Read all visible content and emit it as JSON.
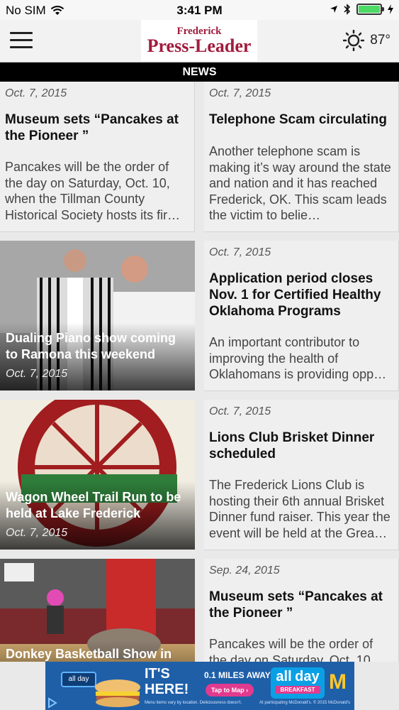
{
  "status": {
    "carrier": "No SIM",
    "time": "3:41 PM"
  },
  "header": {
    "logo_top": "Frederick",
    "logo_main": "Press-Leader",
    "temperature": "87°"
  },
  "section": "NEWS",
  "articles": [
    {
      "date": "Oct. 7, 2015",
      "title": "Museum sets “Pancakes at the Pioneer ”",
      "excerpt": "Pancakes will be the order of the day on Saturday, Oct. 10, when the Tillman County Historical Society hosts its fir…"
    },
    {
      "date": "Oct. 7, 2015",
      "title": "Telephone Scam circulating",
      "excerpt": "Another telephone scam is making it’s way around the state and nation and it has reached Frederick, OK. This scam leads the victim to belie…"
    },
    {
      "date": "Oct. 7, 2015",
      "title": "Dualing Piano show coming to Ramona this weekend"
    },
    {
      "date": "Oct. 7, 2015",
      "title": "Application period closes Nov. 1 for Certified Healthy Oklahoma Programs",
      "excerpt": "An important contributor to improving the health of Oklahomans is providing opp…"
    },
    {
      "date": "Oct. 7, 2015",
      "title": "Wagon Wheel Trail Run to be held at Lake Frederick"
    },
    {
      "date": "Oct. 7, 2015",
      "title": "Lions Club Brisket Dinner scheduled",
      "excerpt": "The Frederick Lions Club is hosting their 6th annual Brisket Dinner fund raiser. This year the event will be held at the Grea…"
    },
    {
      "title": "Donkey Basketball Show in"
    },
    {
      "date": "Sep. 24, 2015",
      "title": "Museum sets “Pancakes at the Pioneer ”",
      "excerpt": "Pancakes will be the order of the day on Saturday, Oct. 10"
    }
  ],
  "ad": {
    "small_tag": "all day",
    "headline_1": "IT'S",
    "headline_2": "HERE!",
    "distance": "0.1 MILES AWAY",
    "cta": "Tap to Map ›",
    "brand_1": "all",
    "brand_2": "day",
    "brand_3": "BREAKFAST",
    "fine_print": "Menu items vary by location. Deliciousness doesn't.",
    "fine_print_2": "At participating McDonald's. © 2015 McDonald's"
  }
}
